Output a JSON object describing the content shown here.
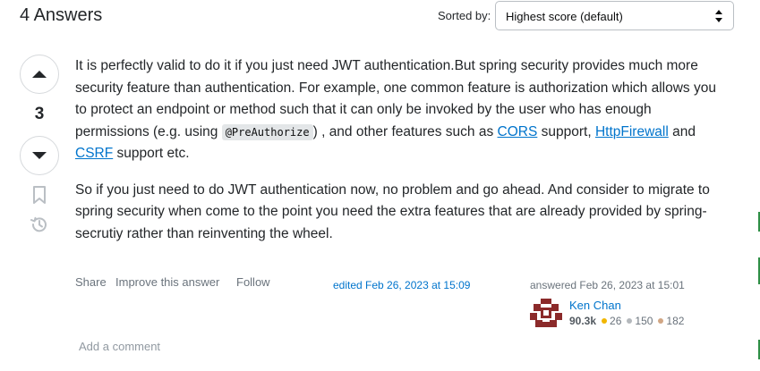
{
  "header": {
    "answers_count": "4 Answers",
    "sorted_by_label": "Sorted by:",
    "sort_selected": "Highest score (default)"
  },
  "vote": {
    "score": "3"
  },
  "post": {
    "p1_a": "It is perfectly valid to do it if you just need JWT authentication.But spring security provides much more security feature than authentication. For example, one common feature is authorization which allows you to protect an endpoint or method such that it can only be invoked by the user who has enough permissions (e.g. using ",
    "p1_code": "@PreAuthorize",
    "p1_b": ") , and other features such as ",
    "link_cors": "CORS",
    "p1_c": " support, ",
    "link_httpfirewall": "HttpFirewall",
    "p1_d": " and ",
    "link_csrf": "CSRF",
    "p1_e": " support etc.",
    "p2": "So if you just need to do JWT authentication now, no problem and go ahead. And consider to migrate to spring security when come to the point you need the extra features that are already provided by spring-secrutiy rather than reinventing the wheel."
  },
  "menu": {
    "share": "Share",
    "improve": "Improve this answer",
    "follow": "Follow"
  },
  "edited": "edited Feb 26, 2023 at 15:09",
  "user": {
    "answered": "answered Feb 26, 2023 at 15:01",
    "name": "Ken Chan",
    "reputation": "90.3k",
    "gold": "26",
    "silver": "150",
    "bronze": "182"
  },
  "add_comment": "Add a comment",
  "colors": {
    "link": "#0074cc",
    "text": "#232629",
    "muted": "#6a737c",
    "avatar": "#8b2a2a"
  }
}
